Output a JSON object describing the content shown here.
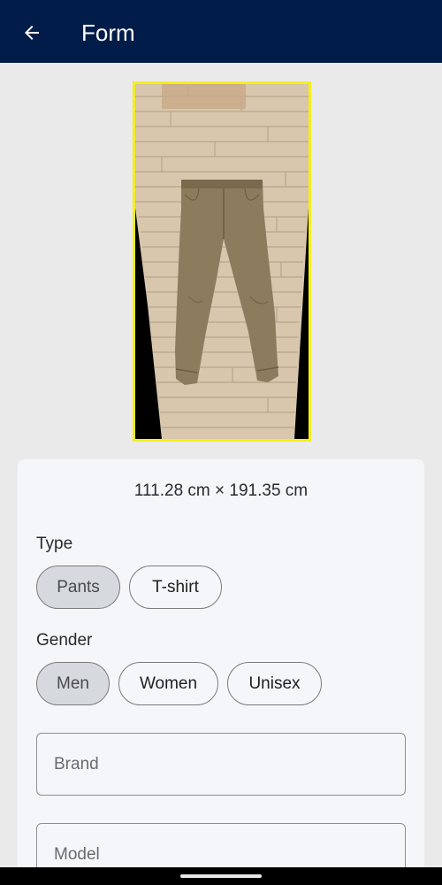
{
  "appbar": {
    "title": "Form",
    "back_icon": "arrow-left-icon",
    "background": "#021c49"
  },
  "photo": {
    "border_color": "#f5ef1a",
    "subject": "khaki-pants-on-wood-floor"
  },
  "measurement": {
    "text": "111.28 cm × 191.35 cm"
  },
  "type": {
    "label": "Type",
    "options": [
      {
        "label": "Pants",
        "selected": true
      },
      {
        "label": "T-shirt",
        "selected": false
      }
    ]
  },
  "gender": {
    "label": "Gender",
    "options": [
      {
        "label": "Men",
        "selected": true
      },
      {
        "label": "Women",
        "selected": false
      },
      {
        "label": "Unisex",
        "selected": false
      }
    ]
  },
  "fields": {
    "brand": {
      "placeholder": "Brand",
      "value": ""
    },
    "model": {
      "placeholder": "Model",
      "value": ""
    }
  }
}
